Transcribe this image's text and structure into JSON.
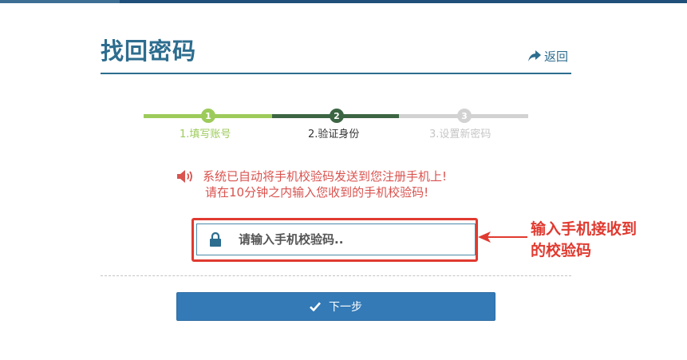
{
  "header": {
    "title": "找回密码",
    "back_label": "返回"
  },
  "steps": [
    {
      "number": "1",
      "label": "1.填写账号",
      "state": "completed"
    },
    {
      "number": "2",
      "label": "2.验证身份",
      "state": "current"
    },
    {
      "number": "3",
      "label": "3.设置新密码",
      "state": "pending"
    }
  ],
  "notice": {
    "line1": "系统已自动将手机校验码发送到您注册手机上!",
    "line2": "请在10分钟之内输入您收到的手机校验码!"
  },
  "code_field": {
    "placeholder": "请输入手机校验码..",
    "value": ""
  },
  "annotation": {
    "line1": "输入手机接收到",
    "line2": "的校验码"
  },
  "actions": {
    "next_label": "下一步"
  },
  "icons": {
    "back": "share-arrow-icon",
    "notice": "speaker-icon",
    "field": "lock-icon",
    "button": "check-icon"
  },
  "colors": {
    "primary": "#337ab7",
    "title": "#2d6d8f",
    "step_done": "#9dcb5b",
    "step_current": "#3c6543",
    "step_pending": "#d2d2d2",
    "notice": "#d9534f",
    "annotation": "#e03a30"
  }
}
